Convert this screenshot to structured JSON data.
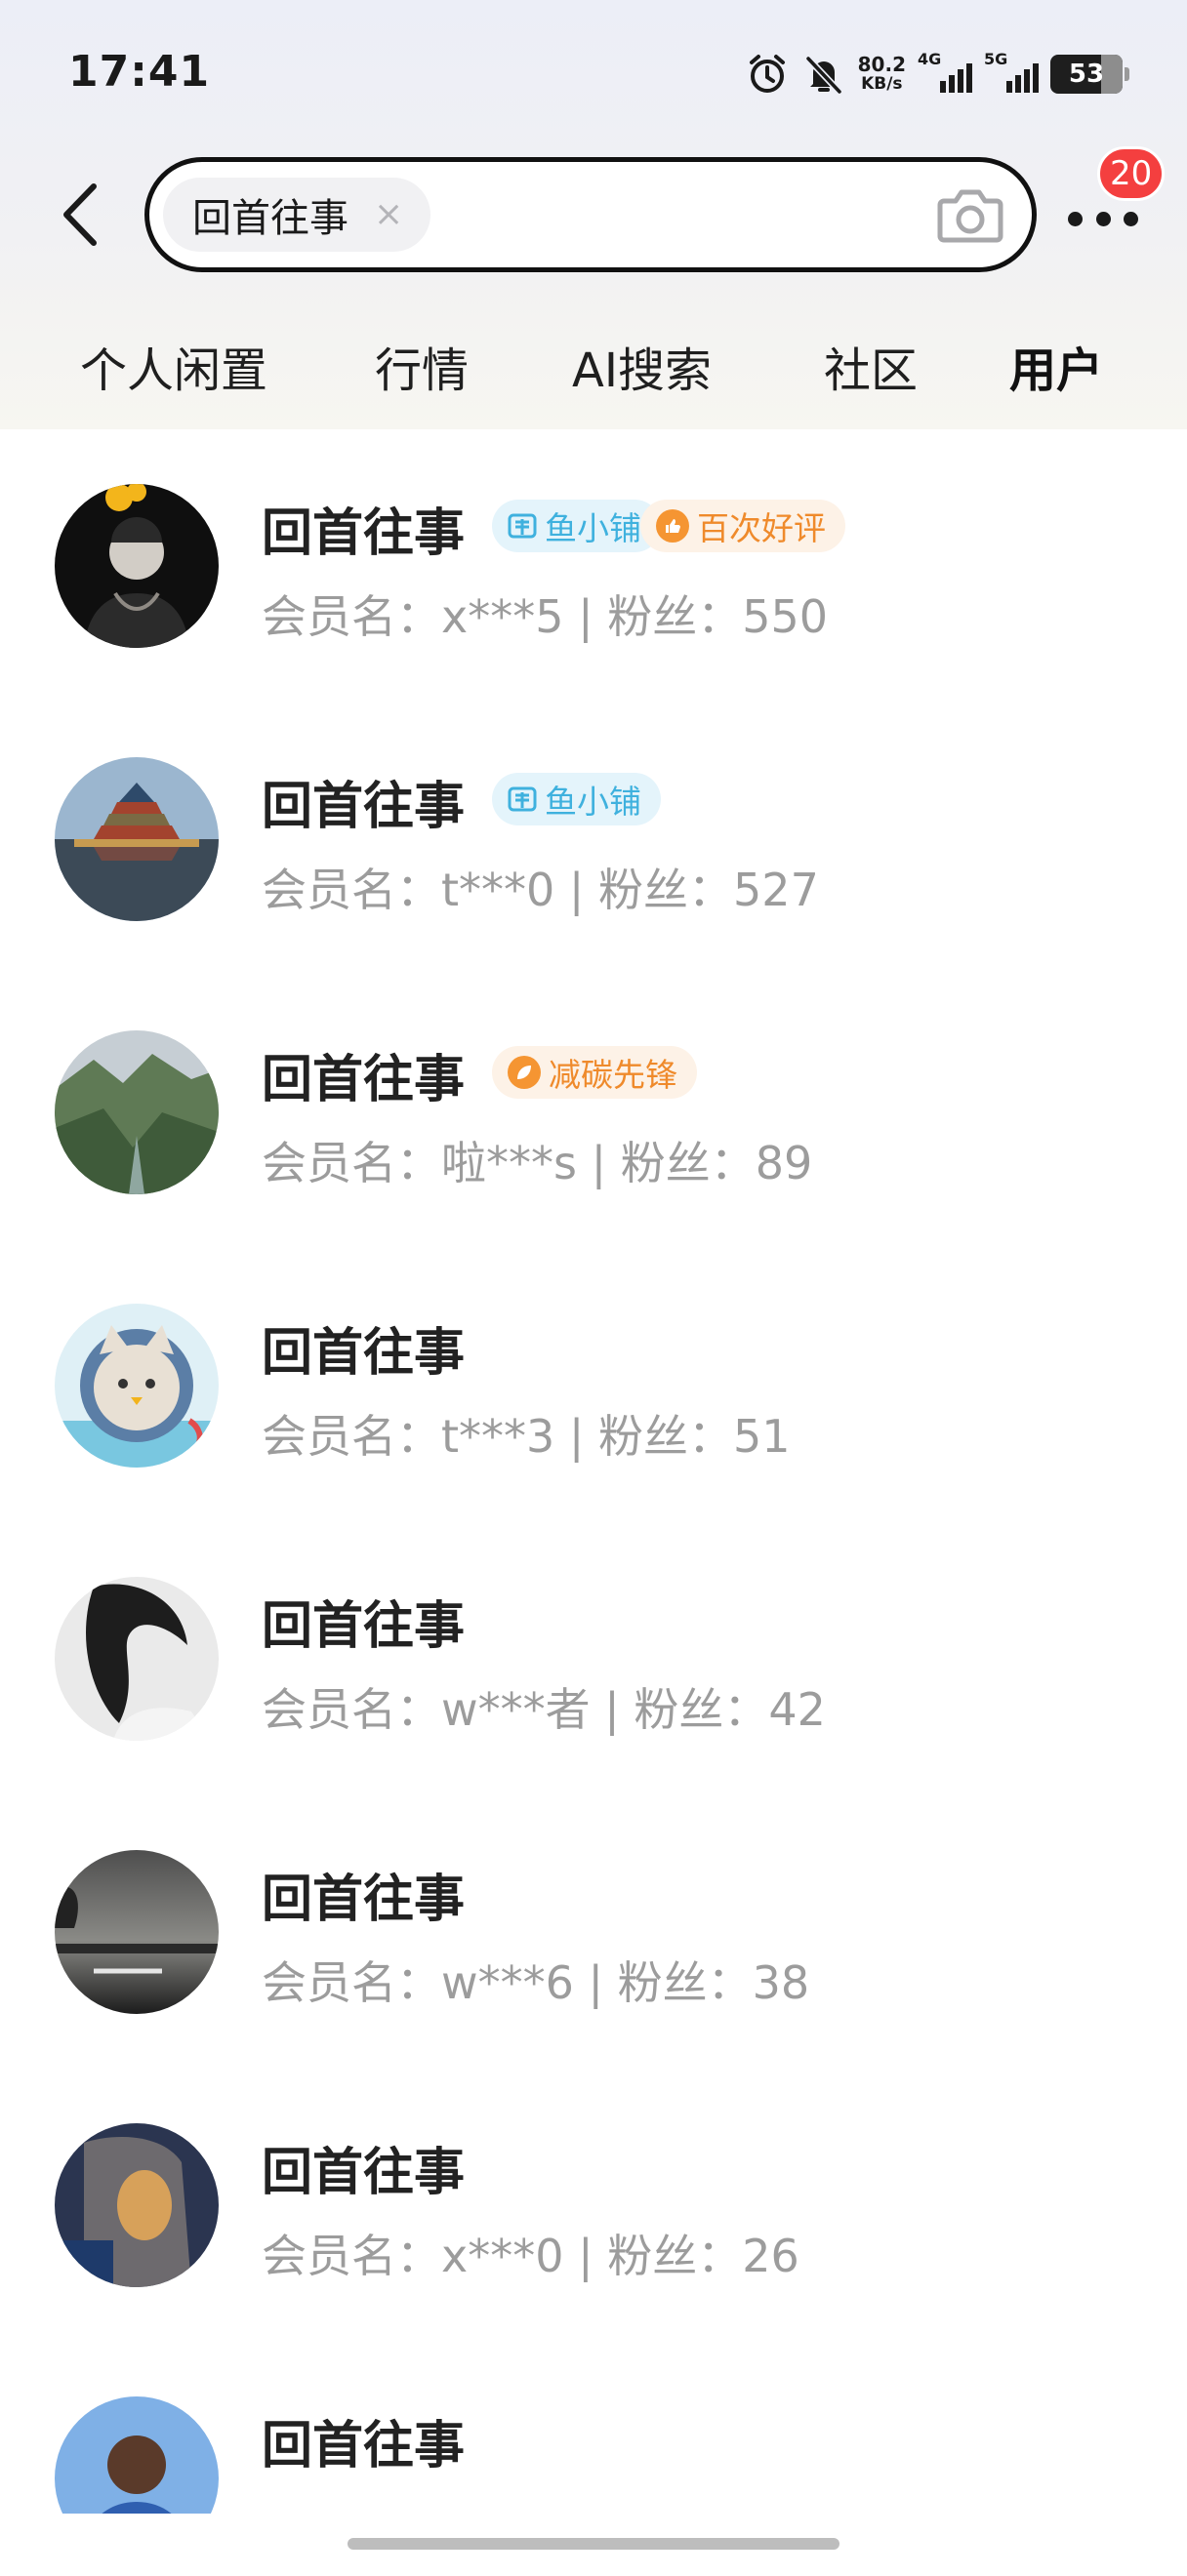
{
  "status_bar": {
    "time": "17:41",
    "net_speed_value": "80.2",
    "net_speed_unit": "KB/s",
    "signal_1_label": "4G",
    "signal_2_label": "5G",
    "battery": "53",
    "icons": [
      "alarm-icon",
      "mute-bell-icon",
      "signal-icon",
      "battery-icon"
    ]
  },
  "header": {
    "query": "回首往事",
    "clear_icon": "×",
    "notification_count": "20"
  },
  "tabs": [
    {
      "label": "个人闲置",
      "active": false
    },
    {
      "label": "行情",
      "active": false
    },
    {
      "label": "AI搜索",
      "active": false
    },
    {
      "label": "社区",
      "active": false
    },
    {
      "label": "用户",
      "active": true
    }
  ],
  "users": [
    {
      "name": "回首往事",
      "meta": "会员名：x***5 | 粉丝：550",
      "tags": [
        {
          "kind": "shop",
          "label": "鱼小铺"
        },
        {
          "kind": "orange",
          "label": "百次好评"
        }
      ]
    },
    {
      "name": "回首往事",
      "meta": "会员名：t***0 | 粉丝：527",
      "tags": [
        {
          "kind": "shop",
          "label": "鱼小铺"
        }
      ]
    },
    {
      "name": "回首往事",
      "meta": "会员名：啦***s | 粉丝：89",
      "tags": [
        {
          "kind": "orange",
          "label": "减碳先锋"
        }
      ]
    },
    {
      "name": "回首往事",
      "meta": "会员名：t***3 | 粉丝：51",
      "tags": []
    },
    {
      "name": "回首往事",
      "meta": "会员名：w***者 | 粉丝：42",
      "tags": []
    },
    {
      "name": "回首往事",
      "meta": "会员名：w***6 | 粉丝：38",
      "tags": []
    },
    {
      "name": "回首往事",
      "meta": "会员名：x***0 | 粉丝：26",
      "tags": []
    },
    {
      "name": "回首往事",
      "meta": "",
      "tags": []
    }
  ],
  "colors": {
    "accent_yellow": "#ffe14d",
    "badge_red": "#f43f3f",
    "shop_tag_blue": "#3fb1de",
    "orange_tag": "#ef8a2b"
  }
}
